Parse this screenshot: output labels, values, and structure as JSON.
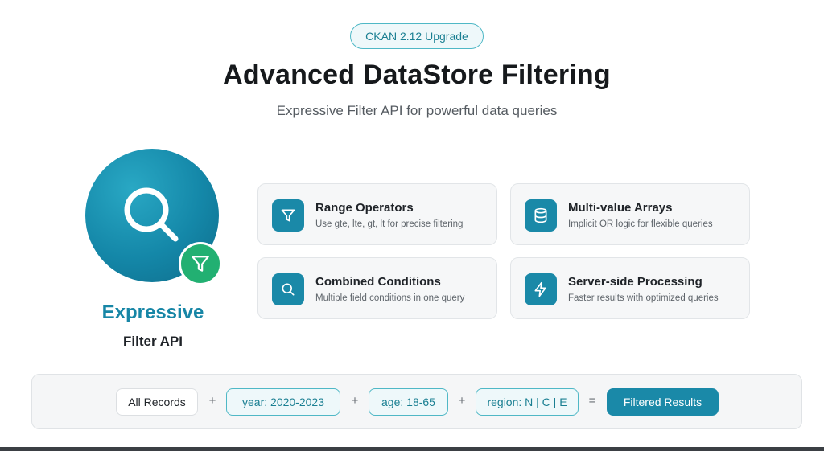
{
  "header": {
    "badge": "CKAN 2.12 Upgrade",
    "title": "Advanced DataStore Filtering",
    "subtitle": "Expressive Filter API for powerful data queries"
  },
  "hero": {
    "icon": "magnifier-icon",
    "sub_icon": "funnel-icon",
    "word": "Expressive",
    "label": "Filter API"
  },
  "features": [
    {
      "icon": "funnel-icon",
      "title": "Range Operators",
      "desc": "Use gte, lte, gt, lt for precise filtering"
    },
    {
      "icon": "database-icon",
      "title": "Multi-value Arrays",
      "desc": "Implicit OR logic for flexible queries"
    },
    {
      "icon": "search-icon",
      "title": "Combined Conditions",
      "desc": "Multiple field conditions in one query"
    },
    {
      "icon": "lightning-icon",
      "title": "Server-side Processing",
      "desc": "Faster results with optimized queries"
    }
  ],
  "formula": {
    "start": "All Records",
    "plus": "+",
    "equals": "=",
    "conditions": [
      "year: 2020-2023",
      "age: 18-65",
      "region: N | C | E"
    ],
    "result": "Filtered Results"
  },
  "colors": {
    "accent": "#1a89a8",
    "accent_light": "#eef8fa",
    "green": "#22b072"
  }
}
